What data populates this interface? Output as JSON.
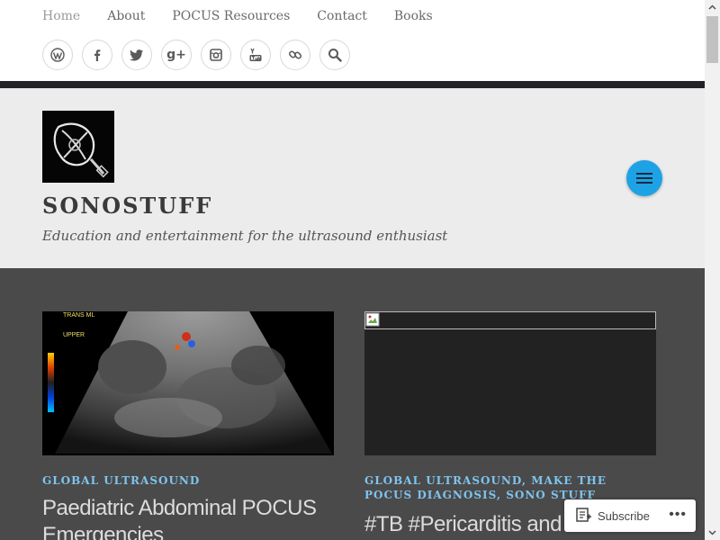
{
  "nav": {
    "items": [
      "Home",
      "About",
      "POCUS Resources",
      "Contact",
      "Books"
    ]
  },
  "social": {
    "icons": [
      "wordpress-icon",
      "facebook-icon",
      "twitter-icon",
      "google-plus-icon",
      "instagram-icon",
      "youtube-icon",
      "link-icon",
      "search-icon"
    ]
  },
  "header": {
    "title": "SONOSTUFF",
    "tagline": "Education and entertainment for the ultrasound enthusiast"
  },
  "posts": [
    {
      "categories": [
        "GLOBAL ULTRASOUND"
      ],
      "title": "Paediatric Abdominal POCUS Emergencies",
      "image_labels": {
        "mode": "TRANS ML",
        "loc": "UPPER"
      }
    },
    {
      "categories": [
        "GLOBAL ULTRASOUND,",
        "MAKE THE POCUS DIAGNOSIS,",
        "SONO STUFF"
      ],
      "title": "#TB #Pericarditis and the new"
    }
  ],
  "subscribe": {
    "label": "Subscribe",
    "more": "•••"
  },
  "colors": {
    "accent": "#1ea2e6",
    "category": "#7fc3ee",
    "content_bg": "#4a4a4a",
    "header_bg": "#ececec",
    "stripe": "#222228"
  }
}
